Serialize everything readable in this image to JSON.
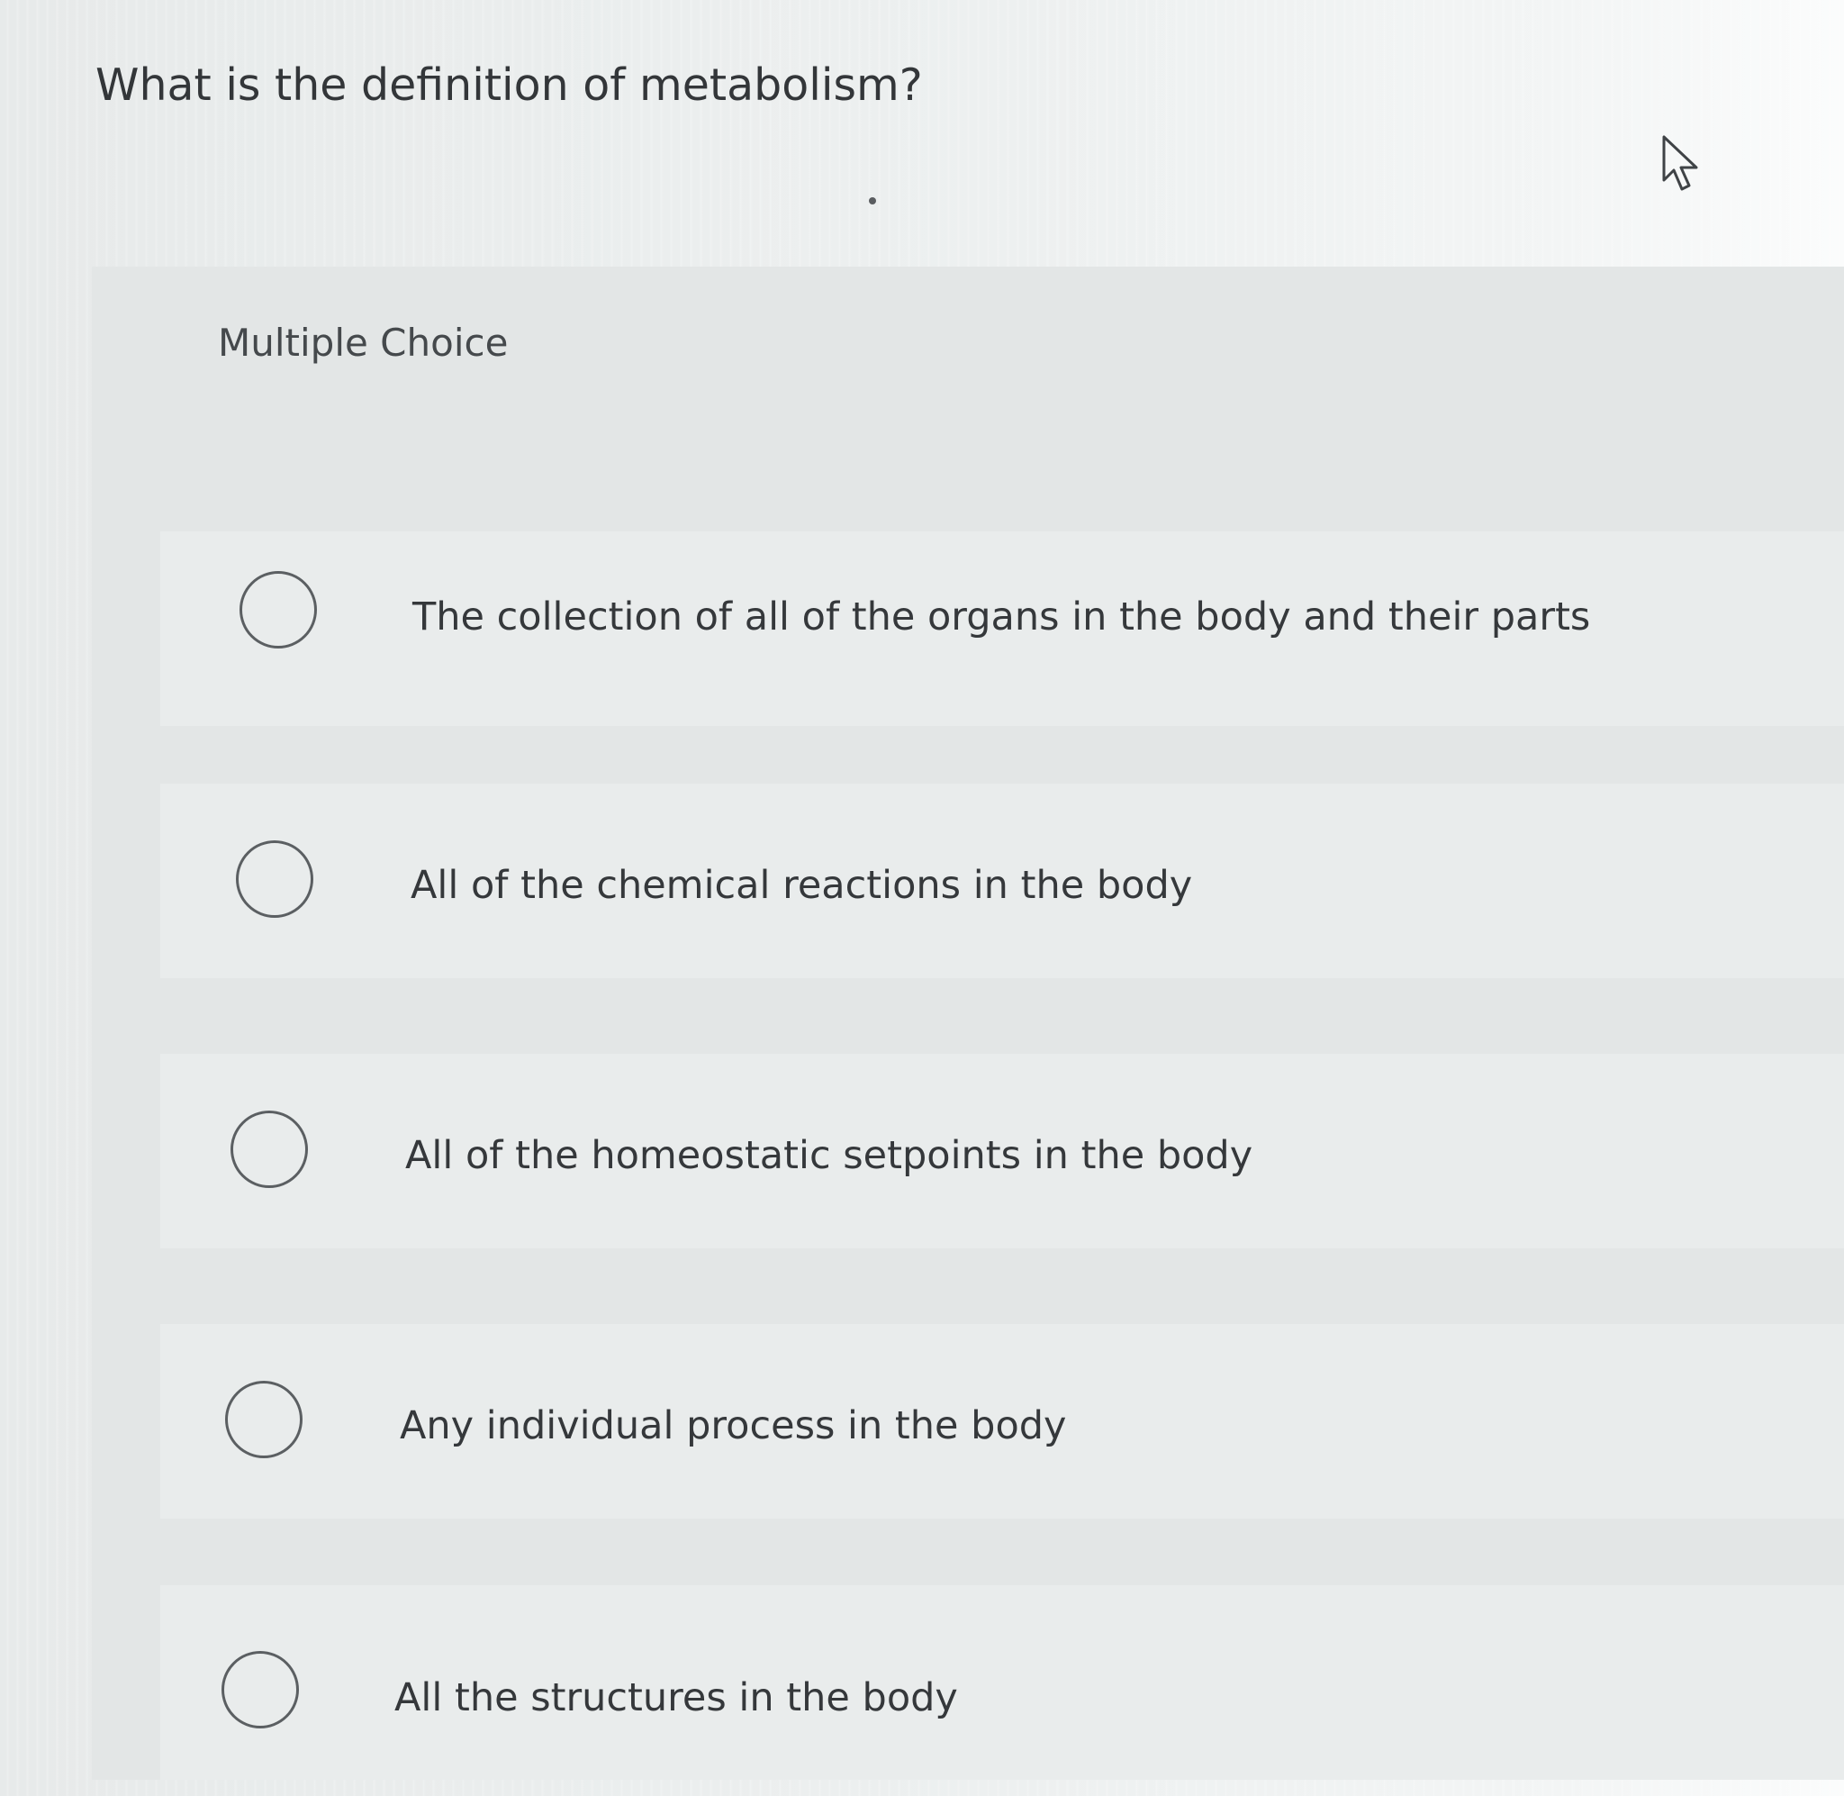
{
  "question": {
    "text": "What is the definition of metabolism?"
  },
  "section": {
    "label": "Multiple Choice"
  },
  "options": [
    {
      "label": "The collection of all of the organs in the body and their parts",
      "selected": false
    },
    {
      "label": "All of the chemical reactions in the body",
      "selected": false
    },
    {
      "label": "All of the homeostatic setpoints in the body",
      "selected": false
    },
    {
      "label": "Any individual process in the body",
      "selected": false
    },
    {
      "label": "All the structures in the body",
      "selected": false
    }
  ],
  "cursor": {
    "icon": "mouse-pointer-icon"
  }
}
